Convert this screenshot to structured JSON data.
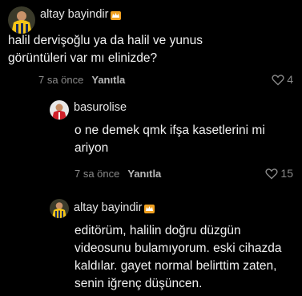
{
  "comments": [
    {
      "username": "altay bayindir",
      "badge_icon": "crown-badge-icon",
      "text_lines": [
        "halil dervişoğlu ya da halil ve yunus",
        "görüntüleri var mı elinizde?"
      ],
      "time": "7 sa önce",
      "reply_label": "Yanıtla",
      "likes": "4"
    },
    {
      "username": "basurolise",
      "text_lines": [
        "o ne demek qmk ifşa kasetlerini mi",
        "ariyon"
      ],
      "time": "7 sa önce",
      "reply_label": "Yanıtla",
      "likes": "15"
    },
    {
      "username": "altay bayindir",
      "badge_icon": "crown-badge-icon",
      "text_lines": [
        "editörüm, halilin doğru düzgün",
        "videosunu bulamıyorum. eski cihazda",
        "kaldılar. gayet normal belirttim zaten,",
        "senin iğrenç düşüncen."
      ]
    }
  ],
  "colors": {
    "background": "#000000",
    "text": "#f2f2f2",
    "muted": "#8a8a8a",
    "jersey_yellow": "#f5c518",
    "jersey_navy": "#1a2a5a",
    "jersey_red": "#d0202a",
    "badge_orange": "#f0a020"
  }
}
